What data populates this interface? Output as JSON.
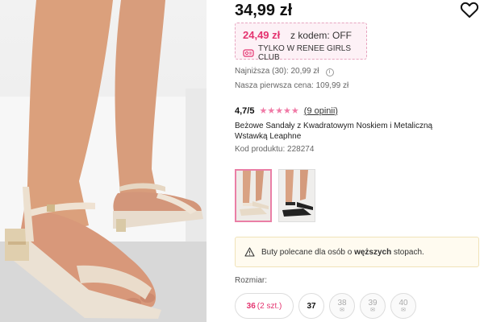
{
  "product": {
    "price": "34,99 zł",
    "promo": {
      "price": "24,49 zł",
      "code_text": "z kodem: OFF",
      "club_text": "TYLKO W RENEE GIRLS CLUB"
    },
    "lowest_price": "Najniższa (30): 20,99 zł",
    "first_price": "Nasza pierwsza cena: 109,99 zł",
    "rating": {
      "value": "4,7/5",
      "stars": "★★★★★",
      "reviews": "(9 opinii)"
    },
    "title_line1": "Beżowe Sandały z Kwadratowym Noskiem i Metaliczną",
    "title_line2": "Wstawką Leaphne",
    "code": "Kod produktu: 228274"
  },
  "notice": {
    "before": "Buty polecane dla osób o ",
    "bold": "węższych",
    "after": " stopach."
  },
  "sizes": {
    "label": "Rozmiar:",
    "items": [
      {
        "label": "36",
        "qty": "(2 szt.)"
      },
      {
        "label": "37"
      },
      {
        "label": "38"
      },
      {
        "label": "39"
      },
      {
        "label": "40"
      }
    ]
  },
  "icons": {
    "favorite": "heart-icon",
    "club": "gift-card-icon",
    "info": "info-icon",
    "notice": "warning-icon",
    "notify": "envelope-icon"
  },
  "colors": {
    "accent": "#e4336f",
    "promo_bg": "#fdf1f6",
    "notice_bg": "#fffbf0",
    "stars": "#f07aa6"
  }
}
